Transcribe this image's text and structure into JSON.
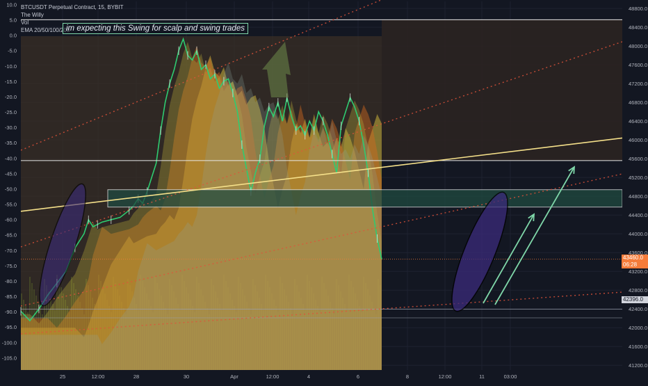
{
  "header": {
    "symbol_line": "BTCUSDT Perpetual Contract, 15, BYBIT",
    "indicator_1": "The Willy",
    "indicator_2": "Vol",
    "indicator_3": "EMA 20/50/100/200"
  },
  "annotation": "im expecting this Swing for scalp and swing trades",
  "price_tag": {
    "price": "43460.0",
    "countdown": "06:28",
    "color": "#f57c3a"
  },
  "level_tag": {
    "price": "42396.0"
  },
  "colors": {
    "background": "#131722",
    "grid": "#1e2230",
    "price_line": "#2ecc71",
    "ema_fill": "#c9b13a",
    "willy_fill": "#d2691e",
    "channel_line": "#e0533a",
    "trendline": "#f5e08a",
    "zone_fill": "#1f4a40",
    "ellipse_fill": "#3a2a7a",
    "arrow": "#7fd7a9"
  },
  "chart_data": {
    "type": "line",
    "title": "BTCUSDT Perpetual Contract, 15, BYBIT",
    "xlabel": "",
    "ylabel": "",
    "x_ticks": [
      "25",
      "12:00",
      "28",
      "30",
      "Apr",
      "12:00",
      "4",
      "6",
      "8",
      "12:00",
      "11",
      "03:00"
    ],
    "right_axis": {
      "ticks": [
        48800,
        48400,
        48000,
        47600,
        47200,
        46800,
        46400,
        46000,
        45600,
        45200,
        44800,
        44400,
        44000,
        43600,
        43200,
        42800,
        42400,
        42000,
        41600,
        41200
      ],
      "labels": [
        "48800.0",
        "48400.0",
        "48000.0",
        "47600.0",
        "47200.0",
        "46800.0",
        "46400.0",
        "46000.0",
        "45600.0",
        "45200.0",
        "44800.0",
        "44400.0",
        "44000.0",
        "43600.0",
        "43200.0",
        "42800.0",
        "42400.0",
        "42000.0",
        "41600.0",
        "41200.0"
      ],
      "ylim": [
        41100,
        48950
      ]
    },
    "left_axis": {
      "name": "The Willy",
      "ticks": [
        10.0,
        5.0,
        0.0,
        -5.0,
        -10.0,
        -15.0,
        -20.0,
        -25.0,
        -30.0,
        -35.0,
        -40.0,
        -45.0,
        -50.0,
        -55.0,
        -60.0,
        -65.0,
        -70.0,
        -75.0,
        -80.0,
        -85.0,
        -90.0,
        -95.0,
        -100.0,
        -105.0
      ],
      "labels": [
        "10.0",
        "5.0",
        "0.0",
        "-5.0",
        "-10.0",
        "-15.0",
        "-20.0",
        "-25.0",
        "-30.0",
        "-35.0",
        "-40.0",
        "-45.0",
        "-50.0",
        "-55.0",
        "-60.0",
        "-65.0",
        "-70.0",
        "-75.0",
        "-80.0",
        "-85.0",
        "-90.0",
        "-95.0",
        "-100.0",
        "-105.0"
      ],
      "ylim": [
        -109,
        11
      ]
    },
    "price_series": {
      "name": "BTCUSDT",
      "points": [
        [
          0,
          42350
        ],
        [
          2,
          42150
        ],
        [
          4,
          42400
        ],
        [
          6,
          42700
        ],
        [
          8,
          42950
        ],
        [
          10,
          43200
        ],
        [
          12,
          43700
        ],
        [
          14,
          44000
        ],
        [
          15,
          44300
        ],
        [
          16,
          44150
        ],
        [
          17,
          44200
        ],
        [
          18,
          44250
        ],
        [
          20,
          44300
        ],
        [
          22,
          44350
        ],
        [
          24,
          44500
        ],
        [
          25,
          44600
        ],
        [
          26,
          44750
        ],
        [
          27,
          44650
        ],
        [
          28,
          44900
        ],
        [
          30,
          45500
        ],
        [
          31,
          46200
        ],
        [
          32,
          46800
        ],
        [
          33,
          47200
        ],
        [
          34,
          47500
        ],
        [
          35,
          47900
        ],
        [
          36,
          48150
        ],
        [
          37,
          47800
        ],
        [
          38,
          47700
        ],
        [
          39,
          47900
        ],
        [
          40,
          47500
        ],
        [
          41,
          47600
        ],
        [
          42,
          47300
        ],
        [
          43,
          47400
        ],
        [
          44,
          47100
        ],
        [
          45,
          47250
        ],
        [
          46,
          47300
        ],
        [
          47,
          47000
        ],
        [
          48,
          46600
        ],
        [
          49,
          45900
        ],
        [
          50,
          45400
        ],
        [
          51,
          44900
        ],
        [
          52,
          45300
        ],
        [
          53,
          45600
        ],
        [
          54,
          46300
        ],
        [
          55,
          46700
        ],
        [
          56,
          46500
        ],
        [
          57,
          46800
        ],
        [
          58,
          46400
        ],
        [
          59,
          46900
        ],
        [
          60,
          46500
        ],
        [
          61,
          46200
        ],
        [
          62,
          46300
        ],
        [
          63,
          46100
        ],
        [
          64,
          46400
        ],
        [
          65,
          46200
        ],
        [
          66,
          46600
        ],
        [
          67,
          46400
        ],
        [
          68,
          46100
        ],
        [
          69,
          45700
        ],
        [
          70,
          45300
        ],
        [
          71,
          46300
        ],
        [
          72,
          46600
        ],
        [
          73,
          46900
        ],
        [
          74,
          46700
        ],
        [
          75,
          46400
        ],
        [
          76,
          45900
        ],
        [
          77,
          45300
        ],
        [
          78,
          44500
        ],
        [
          79,
          43900
        ],
        [
          80,
          43460
        ]
      ]
    },
    "levels": [
      {
        "name": "top line",
        "price": 48560
      },
      {
        "name": "upper line",
        "price": 45560
      },
      {
        "name": "zone top",
        "price": 44940
      },
      {
        "name": "zone bottom",
        "price": 44570
      },
      {
        "name": "last price",
        "price": 43460
      },
      {
        "name": "level",
        "price": 42396
      },
      {
        "name": "lower line",
        "price": 42210
      }
    ],
    "trendline": {
      "from": [
        0,
        44480
      ],
      "to": [
        156,
        46040
      ]
    },
    "grid": true,
    "legend": "none"
  }
}
